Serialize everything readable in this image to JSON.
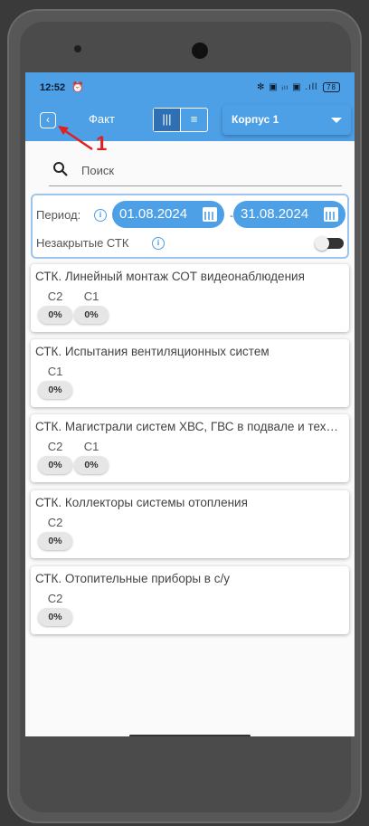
{
  "status_bar": {
    "time": "12:52",
    "alarm_icon": "alarm-clock-icon",
    "right_icons": "✻ ▣ ᵢₗₗ ▣ .ıll",
    "battery": "78"
  },
  "header": {
    "title": "Факт",
    "back_icon": "chevron-left-icon",
    "view_toggle": [
      "columns-view-icon",
      "list-view-icon"
    ],
    "building_select": "Корпус 1",
    "accent_color": "#4d9fe6"
  },
  "annotation": {
    "number": "1",
    "color": "#e02020"
  },
  "search": {
    "placeholder": "Поиск",
    "value": ""
  },
  "filter": {
    "period_label": "Период:",
    "date_from": "01.08.2024",
    "date_separator": "-",
    "date_to": "31.08.2024",
    "unclosed_label": "Незакрытые СТК",
    "unclosed_enabled": false
  },
  "cards": [
    {
      "name": "СТК. Линейный монтаж СОТ видеонаблюдения",
      "columns": [
        {
          "label": "С2",
          "value": "0%"
        },
        {
          "label": "С1",
          "value": "0%"
        }
      ]
    },
    {
      "name": "СТК. Испытания вентиляционных систем",
      "columns": [
        {
          "label": "С1",
          "value": "0%"
        }
      ]
    },
    {
      "name": "СТК. Магистрали систем ХВС, ГВС в подвале и техподполье",
      "columns": [
        {
          "label": "С2",
          "value": "0%"
        },
        {
          "label": "С1",
          "value": "0%"
        }
      ]
    },
    {
      "name": "СТК. Коллекторы системы отопления",
      "columns": [
        {
          "label": "С2",
          "value": "0%"
        }
      ]
    },
    {
      "name": "СТК. Отопительные приборы в с/у",
      "columns": [
        {
          "label": "С2",
          "value": "0%"
        }
      ]
    }
  ]
}
